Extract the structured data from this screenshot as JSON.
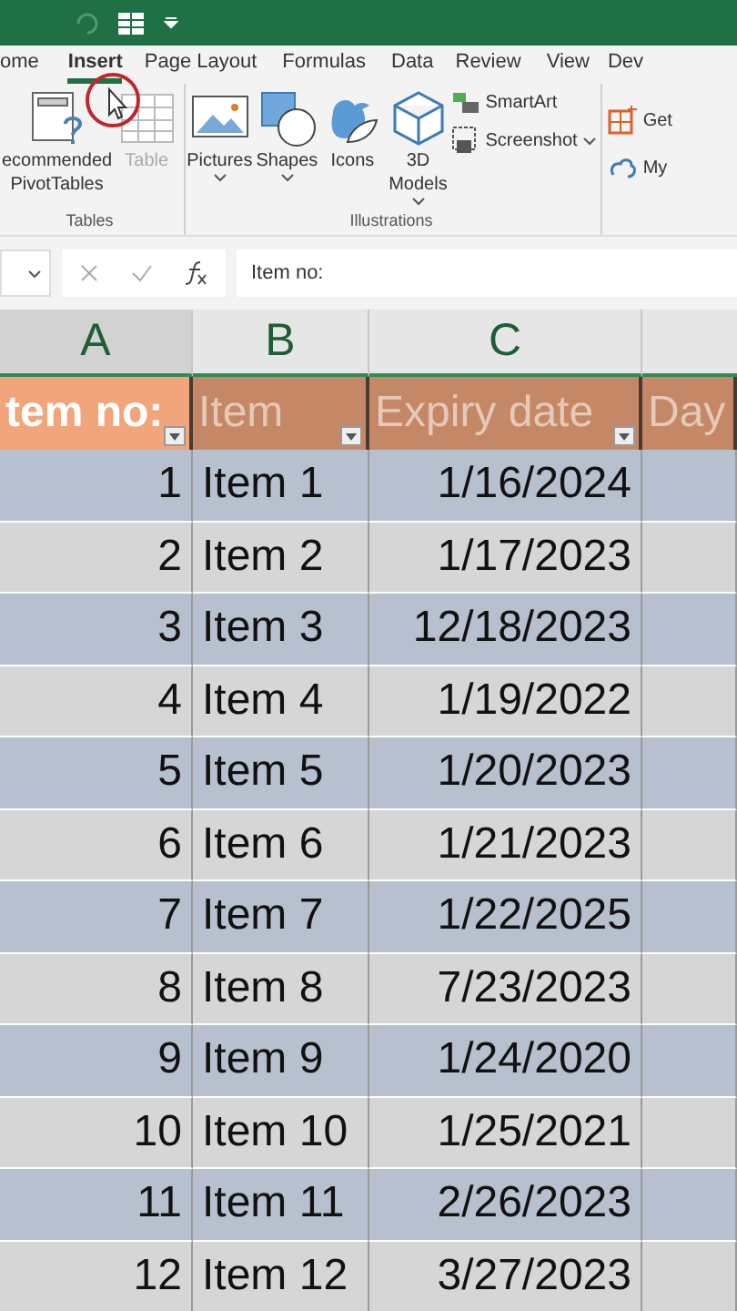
{
  "ribbon_tabs": [
    {
      "label": "ome",
      "selected": false
    },
    {
      "label": "Insert",
      "selected": true
    },
    {
      "label": "Page Layout",
      "selected": false
    },
    {
      "label": "Formulas",
      "selected": false
    },
    {
      "label": "Data",
      "selected": false
    },
    {
      "label": "Review",
      "selected": false
    },
    {
      "label": "View",
      "selected": false
    },
    {
      "label": "Dev",
      "selected": false
    }
  ],
  "ribbon_groups": [
    {
      "label": "Tables",
      "buttons": [
        {
          "kind": "pivot",
          "lines": [
            "ecommended",
            "PivotTables"
          ],
          "disabled": false,
          "caret": false
        },
        {
          "kind": "table",
          "lines": [
            "Table"
          ],
          "disabled": true,
          "caret": false
        }
      ]
    },
    {
      "label": "Illustrations",
      "buttons": [
        {
          "kind": "pictures",
          "lines": [
            "Pictures"
          ],
          "disabled": false,
          "caret": true
        },
        {
          "kind": "shapes",
          "lines": [
            "Shapes"
          ],
          "disabled": false,
          "caret": true
        },
        {
          "kind": "icons",
          "lines": [
            "Icons"
          ],
          "disabled": false,
          "caret": false
        },
        {
          "kind": "models",
          "lines": [
            "3D",
            "Models"
          ],
          "disabled": false,
          "caret": true
        }
      ],
      "small_buttons": [
        {
          "kind": "smartart",
          "label": "SmartArt",
          "caret": false
        },
        {
          "kind": "screenshot",
          "label": "Screenshot",
          "caret": true
        }
      ]
    }
  ],
  "ribbon_extra": [
    {
      "kind": "get",
      "label": "Get"
    },
    {
      "kind": "my",
      "label": "My"
    }
  ],
  "formula_bar": {
    "value": "Item no:"
  },
  "columns": [
    {
      "label": "A",
      "selected": true
    },
    {
      "label": "B",
      "selected": false
    },
    {
      "label": "C",
      "selected": false
    }
  ],
  "header_row": [
    {
      "text": "tem no:",
      "selected": true,
      "filter": true
    },
    {
      "text": "Item",
      "selected": false,
      "filter": true
    },
    {
      "text": "Expiry date",
      "selected": false,
      "filter": true
    },
    {
      "text": "Day",
      "selected": false,
      "filter": false
    }
  ],
  "rows": [
    [
      "1",
      "Item 1",
      "1/16/2024"
    ],
    [
      "2",
      "Item 2",
      "1/17/2023"
    ],
    [
      "3",
      "Item 3",
      "12/18/2023"
    ],
    [
      "4",
      "Item 4",
      "1/19/2022"
    ],
    [
      "5",
      "Item 5",
      "1/20/2023"
    ],
    [
      "6",
      "Item 6",
      "1/21/2023"
    ],
    [
      "7",
      "Item 7",
      "1/22/2025"
    ],
    [
      "8",
      "Item 8",
      "7/23/2023"
    ],
    [
      "9",
      "Item 9",
      "1/24/2020"
    ],
    [
      "10",
      "Item 10",
      "1/25/2021"
    ],
    [
      "11",
      "Item 11",
      "2/26/2023"
    ],
    [
      "12",
      "Item 12",
      "3/27/2023"
    ]
  ]
}
